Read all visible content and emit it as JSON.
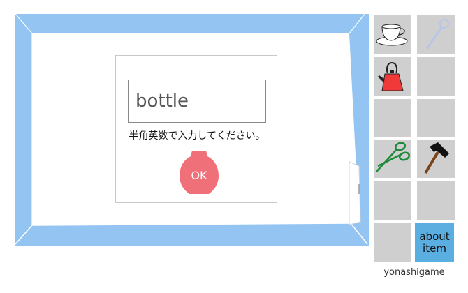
{
  "dialog": {
    "input_value": "bottle",
    "hint": "半角英数で入力してください。",
    "ok_label": "OK"
  },
  "inventory": {
    "slots": [
      {
        "icon": "teacup-icon"
      },
      {
        "icon": "wand-icon"
      },
      {
        "icon": "kettle-icon"
      },
      {
        "icon": ""
      },
      {
        "icon": ""
      },
      {
        "icon": ""
      },
      {
        "icon": "scissors-icon"
      },
      {
        "icon": "hammer-icon"
      },
      {
        "icon": ""
      },
      {
        "icon": ""
      },
      {
        "icon": ""
      }
    ],
    "about_line1": "about",
    "about_line2": "item"
  },
  "brand": "yonashigame",
  "colors": {
    "wall_blue": "#94c4f2",
    "slot_gray": "#cfcfcf",
    "ok_red": "#f0707a",
    "about_blue": "#5aaee0"
  }
}
